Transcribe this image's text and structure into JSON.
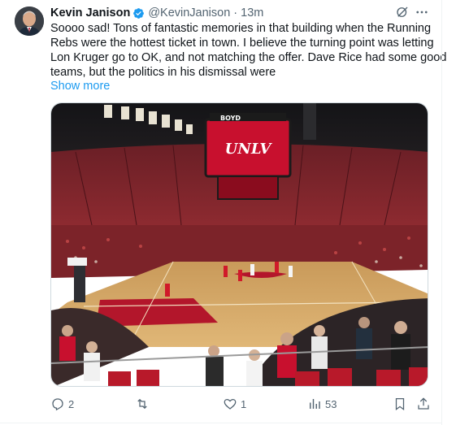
{
  "author": {
    "name": "Kevin Janison",
    "handle": "@KevinJanison",
    "separator": "·",
    "time": "13m"
  },
  "tweet": {
    "lines": [
      "Soooo sad!  Tons of fantastic memories in that building when the Running",
      "Rebs were the hottest ticket in town.  I believe the turning point was letting",
      "Lon Kruger go to OK, and not matching the offer.  Dave Rice had some good",
      "teams, but the politics in his dismissal were"
    ],
    "show_more": "Show more"
  },
  "media": {
    "scoreboard_text": "UNLV",
    "banner_text": "BOYD"
  },
  "actions": {
    "replies": "2",
    "reposts": "",
    "likes": "1",
    "views": "53"
  },
  "colors": {
    "accent": "#1d9bf0",
    "secondary_text": "#536471",
    "court_red": "#c8102e"
  }
}
